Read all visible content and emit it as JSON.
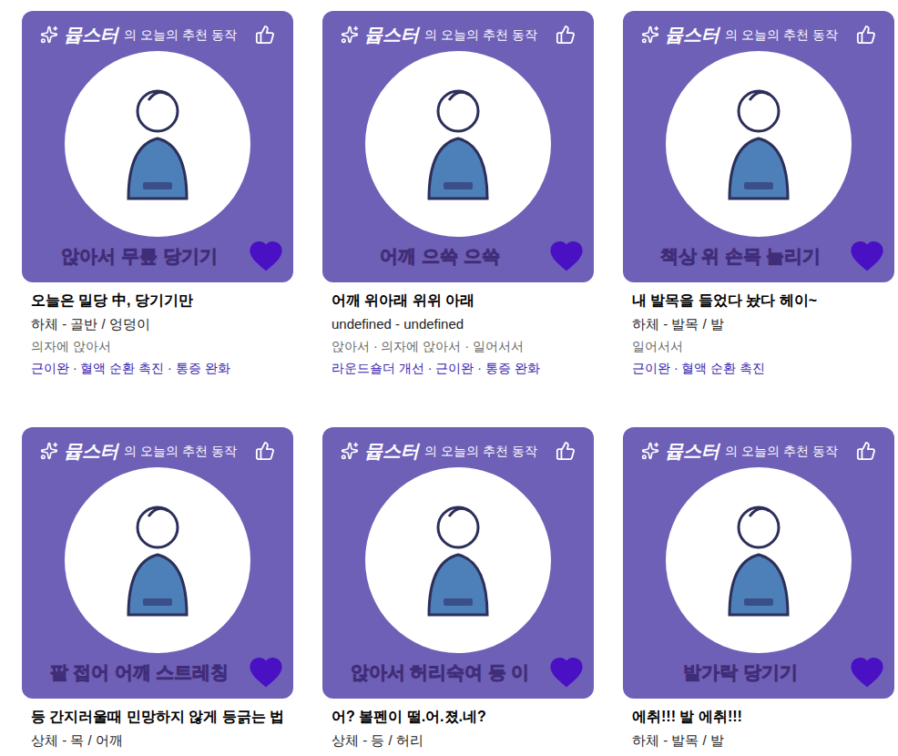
{
  "banner": {
    "brand": "뮵스터",
    "headline": "의 오늘의 추천 동작"
  },
  "cards": [
    {
      "caption": "앉아서 무릎 당기기",
      "liked": true,
      "title": "오늘은 밀당 中, 당기기만",
      "category": "하체 - 골반 / 엉덩이",
      "posture": "의자에 앉아서",
      "effects": "근이완 · 혈액 순환 촉진 · 통증 완화"
    },
    {
      "caption": "어깨 으쓱 으쓱",
      "liked": true,
      "title": "어깨 위아래 위위 아래",
      "category": "undefined - undefined",
      "posture": "앉아서 · 의자에 앉아서 · 일어서서",
      "effects": "라운드숄더 개선 · 근이완 · 통증 완화"
    },
    {
      "caption": "책상 위 손목 늘리기",
      "liked": true,
      "title": "내 발목을 들었다 놨다 헤이~",
      "category": "하체 - 발목 / 발",
      "posture": "일어서서",
      "effects": "근이완 · 혈액 순환 촉진"
    },
    {
      "caption": "팔 접어 어깨 스트레칭",
      "liked": true,
      "title": "등 간지러울때 민망하지 않게 등긁는 법",
      "category": "상체 - 목 / 어깨"
    },
    {
      "caption": "앉아서 허리숙여 등 이",
      "liked": true,
      "title": "어? 볼펜이 떨.어.졌.네?",
      "category": "상체 - 등 / 허리"
    },
    {
      "caption": "발가락 당기기",
      "liked": true,
      "title": "에취!!! 발 에취!!!",
      "category": "하체 - 발목 / 발"
    }
  ]
}
